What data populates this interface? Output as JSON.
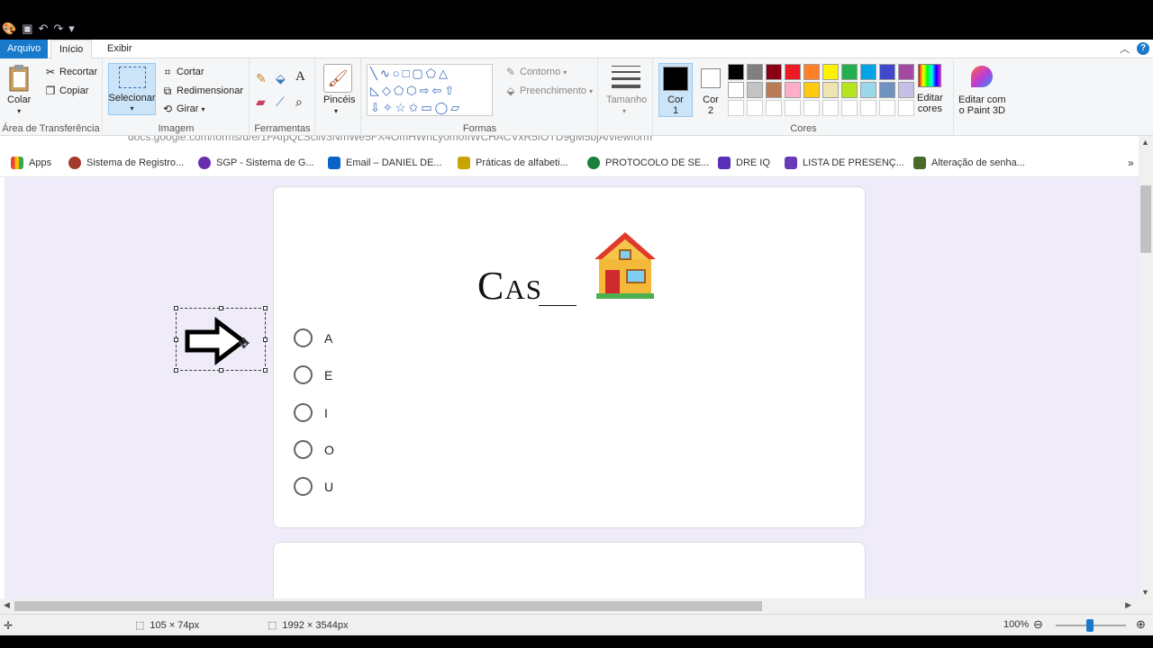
{
  "window": {
    "tabs": {
      "file": "Arquivo",
      "home": "Início",
      "view": "Exibir"
    },
    "help": "?"
  },
  "ribbon": {
    "clipboard": {
      "paste": "Colar",
      "cut": "Recortar",
      "copy": "Copiar",
      "label": "Área de Transferência"
    },
    "image": {
      "select": "Selecionar",
      "crop": "Cortar",
      "resize": "Redimensionar",
      "rotate": "Girar",
      "label": "Imagem"
    },
    "tools": {
      "label": "Ferramentas"
    },
    "brushes": {
      "label": "Pincéis"
    },
    "shapes": {
      "outline": "Contorno",
      "fill": "Preenchimento",
      "label": "Formas"
    },
    "size": {
      "label": "Tamanho"
    },
    "colors": {
      "color1": "Cor 1",
      "color1_line1": "Cor",
      "color1_line2": "1",
      "color2_line1": "Cor",
      "color2_line2": "2",
      "edit_line1": "Editar",
      "edit_line2": "cores",
      "paint3d_line1": "Editar com",
      "paint3d_line2": "o Paint 3D",
      "label": "Cores",
      "palette_row1": [
        "#000000",
        "#7f7f7f",
        "#880015",
        "#ed1c24",
        "#ff7f27",
        "#fff200",
        "#22b14c",
        "#00a2e8",
        "#3f48cc",
        "#a349a4"
      ],
      "palette_row2": [
        "#ffffff",
        "#c3c3c3",
        "#b97a57",
        "#ffaec9",
        "#ffc90e",
        "#efe4b0",
        "#b5e61d",
        "#99d9ea",
        "#7092be",
        "#c8bfe7"
      ]
    }
  },
  "browser": {
    "address": "docs.google.com/forms/d/e/1FAIpQLScilv3NmWe5FX4OmHWhLy0m0IIWCHACVxR5fOTD9gM5bjA/viewform",
    "bookmarks": [
      {
        "label": "Apps",
        "color": "#ea4335"
      },
      {
        "label": "Sistema de Registro...",
        "color": "#a33a2a"
      },
      {
        "label": "SGP - Sistema de G...",
        "color": "#6a2fb0"
      },
      {
        "label": "Email – DANIEL DE...",
        "color": "#0a64c8"
      },
      {
        "label": "Práticas de alfabeti...",
        "color": "#c9a400"
      },
      {
        "label": "PROTOCOLO DE SE...",
        "color": "#188038"
      },
      {
        "label": "DRE IQ",
        "color": "#5a2fb8"
      },
      {
        "label": "LISTA DE PRESENÇ...",
        "color": "#673ab7"
      },
      {
        "label": "Alteração de senha...",
        "color": "#4a6a2a"
      }
    ]
  },
  "form": {
    "question_text": "Cas",
    "options": [
      "A",
      "E",
      "I",
      "O",
      "U"
    ]
  },
  "status": {
    "selection_size": "105 × 74px",
    "image_size": "1992 × 3544px",
    "zoom": "100%"
  }
}
